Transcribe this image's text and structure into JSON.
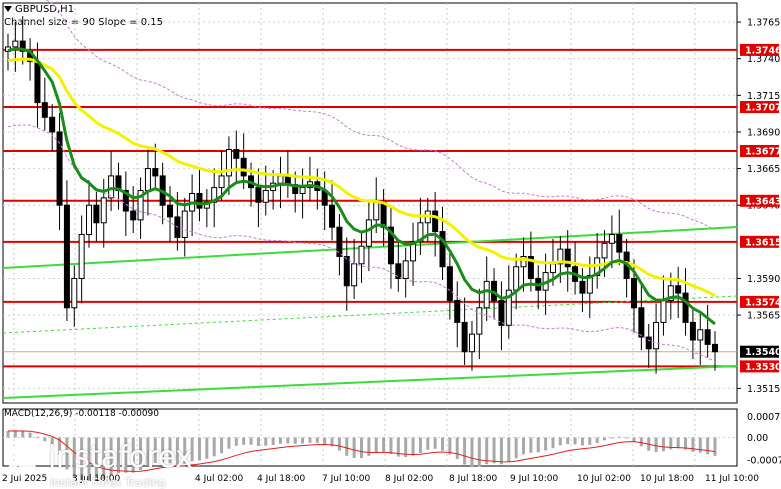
{
  "chart_data": {
    "type": "candlestick",
    "symbol_title": "GBPUSD,H1",
    "annotation": "Channel size = 90 Slope = 0.15",
    "price_axis": {
      "range": [
        1.3505,
        1.3778
      ],
      "ticks": [
        "1.3765",
        "1.3740",
        "1.3715",
        "1.3690",
        "1.3665",
        "1.3640",
        "1.3590",
        "1.3565",
        "1.3515"
      ]
    },
    "levels": [
      {
        "label": "1.3746",
        "value": 1.3746
      },
      {
        "label": "1.3707",
        "value": 1.3707
      },
      {
        "label": "1.3677",
        "value": 1.3677
      },
      {
        "label": "1.3643",
        "value": 1.3643
      },
      {
        "label": "1.3615",
        "value": 1.3615
      },
      {
        "label": "1.3574",
        "value": 1.3574
      },
      {
        "label": "1.3530",
        "value": 1.353
      }
    ],
    "current_price": {
      "label": "1.3540",
      "value": 1.354
    },
    "time_labels": [
      "2 Jul 2025",
      "3 Jul 10:00",
      "4 Jul 02:00",
      "4 Jul 18:00",
      "7 Jul 10:00",
      "8 Jul 02:00",
      "8 Jul 18:00",
      "9 Jul 10:00",
      "10 Jul 02:00",
      "10 Jul 18:00",
      "11 Jul 10:00"
    ],
    "closes": [
      1.3748,
      1.3752,
      1.3745,
      1.3738,
      1.371,
      1.37,
      1.369,
      1.364,
      1.357,
      1.359,
      1.362,
      1.364,
      1.3628,
      1.3645,
      1.366,
      1.365,
      1.3636,
      1.363,
      1.365,
      1.3665,
      1.366,
      1.364,
      1.3632,
      1.3618,
      1.3636,
      1.3648,
      1.3638,
      1.3642,
      1.3652,
      1.366,
      1.3678,
      1.3672,
      1.366,
      1.3652,
      1.3642,
      1.365,
      1.3655,
      1.366,
      1.3654,
      1.3648,
      1.3652,
      1.3656,
      1.365,
      1.364,
      1.3625,
      1.3605,
      1.3585,
      1.36,
      1.3612,
      1.363,
      1.3642,
      1.3625,
      1.36,
      1.359,
      1.3602,
      1.3615,
      1.3628,
      1.3636,
      1.3622,
      1.3598,
      1.3575,
      1.356,
      1.354,
      1.3552,
      1.357,
      1.3588,
      1.3575,
      1.3558,
      1.3582,
      1.3598,
      1.3605,
      1.359,
      1.3582,
      1.3594,
      1.36,
      1.361,
      1.3598,
      1.3588,
      1.358,
      1.3592,
      1.3604,
      1.3614,
      1.362,
      1.3608,
      1.359,
      1.357,
      1.355,
      1.3542,
      1.356,
      1.3575,
      1.3585,
      1.358,
      1.356,
      1.3548,
      1.3555,
      1.3545,
      1.354
    ],
    "ma_green_start": 1.3745,
    "ma_yellow_start": 1.3738,
    "macd": {
      "label": "MACD(12,26,9) -0.00118 -0.00090",
      "ticks": [
        "0.00072",
        "0.00",
        "-0.00077"
      ],
      "range": [
        -0.0009,
        0.0009
      ]
    }
  },
  "branding": {
    "brand": "instaforex",
    "tagline": "Instant Forex Trading"
  }
}
